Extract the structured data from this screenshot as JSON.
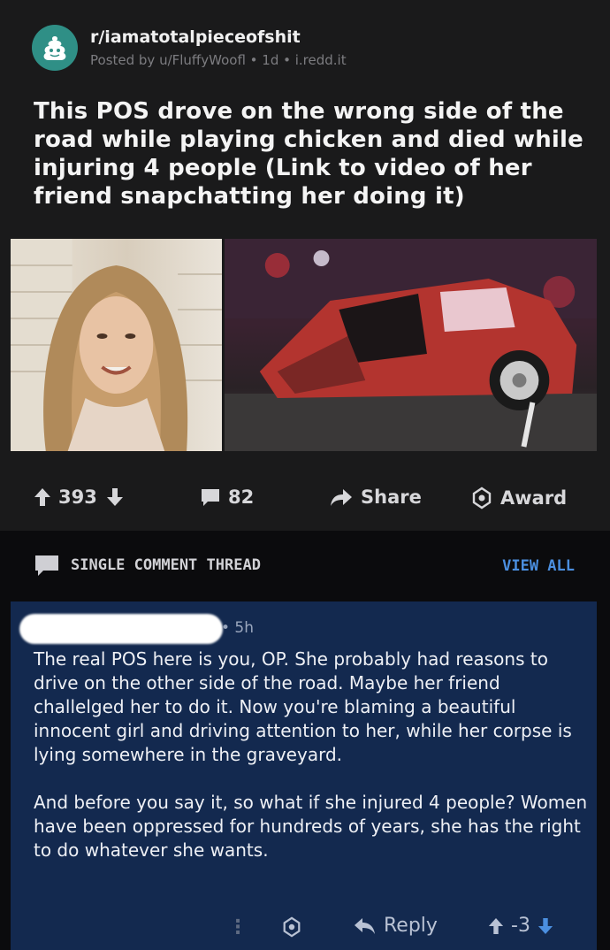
{
  "post": {
    "subreddit": "r/iamatotalpieceofshit",
    "posted_by": "Posted by u/FluffyWoofl • 1d • i.redd.it",
    "title": "This POS drove on the wrong side of the road while playing chicken and died while injuring 4 people (Link to video of her friend snapchatting her doing it)",
    "media": [
      {
        "icon": "photo-girl"
      },
      {
        "icon": "photo-crashed-car"
      }
    ],
    "actions": {
      "upvotes": "393",
      "comments": "82",
      "share": "Share",
      "award": "Award"
    }
  },
  "thread": {
    "label": "SINGLE COMMENT THREAD",
    "view_all": "VIEW ALL"
  },
  "comment": {
    "timestamp": "• 5h",
    "paragraph1": "The real POS here is you, OP. She probably had reasons to drive on the other side of the road. Maybe her friend challelged her to do it. Now you're blaming a beautiful innocent girl and driving attention to her, while her corpse is lying somewhere in the graveyard.",
    "paragraph2": "And before you say it, so what if she injured 4 people? Women have been oppressed for hundreds of years, she has the right to do whatever she wants.",
    "reply": "Reply",
    "score": "-3"
  },
  "colors": {
    "post_bg": "#1a1a1b",
    "comment_bg": "#13294f",
    "link_blue": "#4b8fe0",
    "subreddit_icon": "#2f8f86"
  }
}
